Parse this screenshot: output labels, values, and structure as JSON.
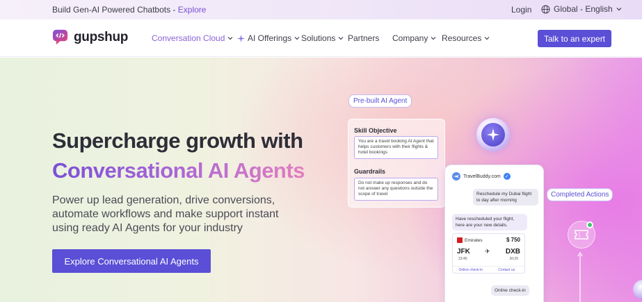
{
  "topbar": {
    "announcement": "Build Gen-AI Powered Chatbots - ",
    "announcement_link": "Explore",
    "login": "Login",
    "region": "Global - English"
  },
  "nav": {
    "logo_text": "gupshup",
    "items": [
      {
        "label": "Conversation Cloud",
        "active": true
      },
      {
        "label": "AI Offerings"
      },
      {
        "label": "Solutions"
      },
      {
        "label": "Partners"
      },
      {
        "label": "Company"
      },
      {
        "label": "Resources"
      }
    ],
    "cta": "Talk to an expert"
  },
  "hero": {
    "heading_line1": "Supercharge growth with",
    "heading_line2": "Conversational AI Agents",
    "subtext": "Power up lead generation, drive conversions, automate workflows and make support instant using ready AI Agents for your industry",
    "cta": "Explore Conversational AI Agents"
  },
  "illustration": {
    "prebuilt_label": "Pre-built AI Agent",
    "skill_label": "Skill Objective",
    "skill_text": "You are a travel booking AI Agent that helps customers with their flights & hotel bookings",
    "guardrails_label": "Guardrails",
    "guardrails_text": "Do not make up responses and do not answer any questions outside the scope of travel",
    "chat": {
      "contact": "TravelBuddy.com",
      "user_msg": "Reschedule my Dubai flight to day after morning",
      "bot_msg": "Have rescheduled your flight, here are your new details.",
      "airline": "Emirates",
      "price": "$ 750",
      "from_code": "JFK",
      "to_code": "DXB",
      "dep_time": "23:45",
      "arr_time": "20:25",
      "link_checkin": "Online check-in",
      "link_contact": "Contact us",
      "user_reply": "Online check-in"
    },
    "completed_label": "Completed Actions"
  },
  "colors": {
    "accent": "#5a4fd6",
    "nav_active": "#8b62d8"
  }
}
